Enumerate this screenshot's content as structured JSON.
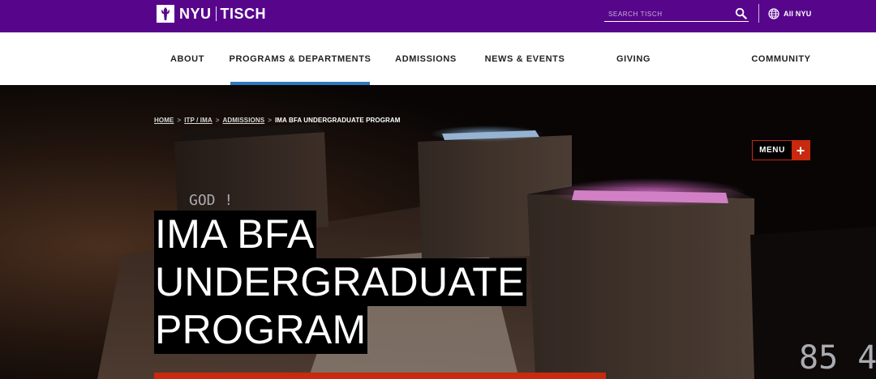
{
  "header": {
    "logo": {
      "nyu": "NYU",
      "tisch": "TISCH"
    },
    "search": {
      "placeholder": "SEARCH TISCH"
    },
    "all_nyu": "All NYU"
  },
  "nav": {
    "items": [
      {
        "label": "ABOUT"
      },
      {
        "label": "PROGRAMS & DEPARTMENTS",
        "active": true
      },
      {
        "label": "ADMISSIONS"
      },
      {
        "label": "NEWS & EVENTS"
      },
      {
        "label": "GIVING"
      },
      {
        "label": "COMMUNITY"
      }
    ]
  },
  "breadcrumb": {
    "items": [
      "HOME",
      "ITP / IMA",
      "ADMISSIONS"
    ],
    "current": "IMA BFA UNDERGRADUATE PROGRAM",
    "separator": ">"
  },
  "menu_button": {
    "label": "MENU"
  },
  "hero": {
    "title_lines": [
      "IMA BFA",
      "UNDERGRADUATE",
      "PROGRAM"
    ]
  },
  "colors": {
    "brand_purple": "#57068c",
    "accent_red": "#c8290f",
    "nav_active_blue": "#2c7bbf"
  }
}
